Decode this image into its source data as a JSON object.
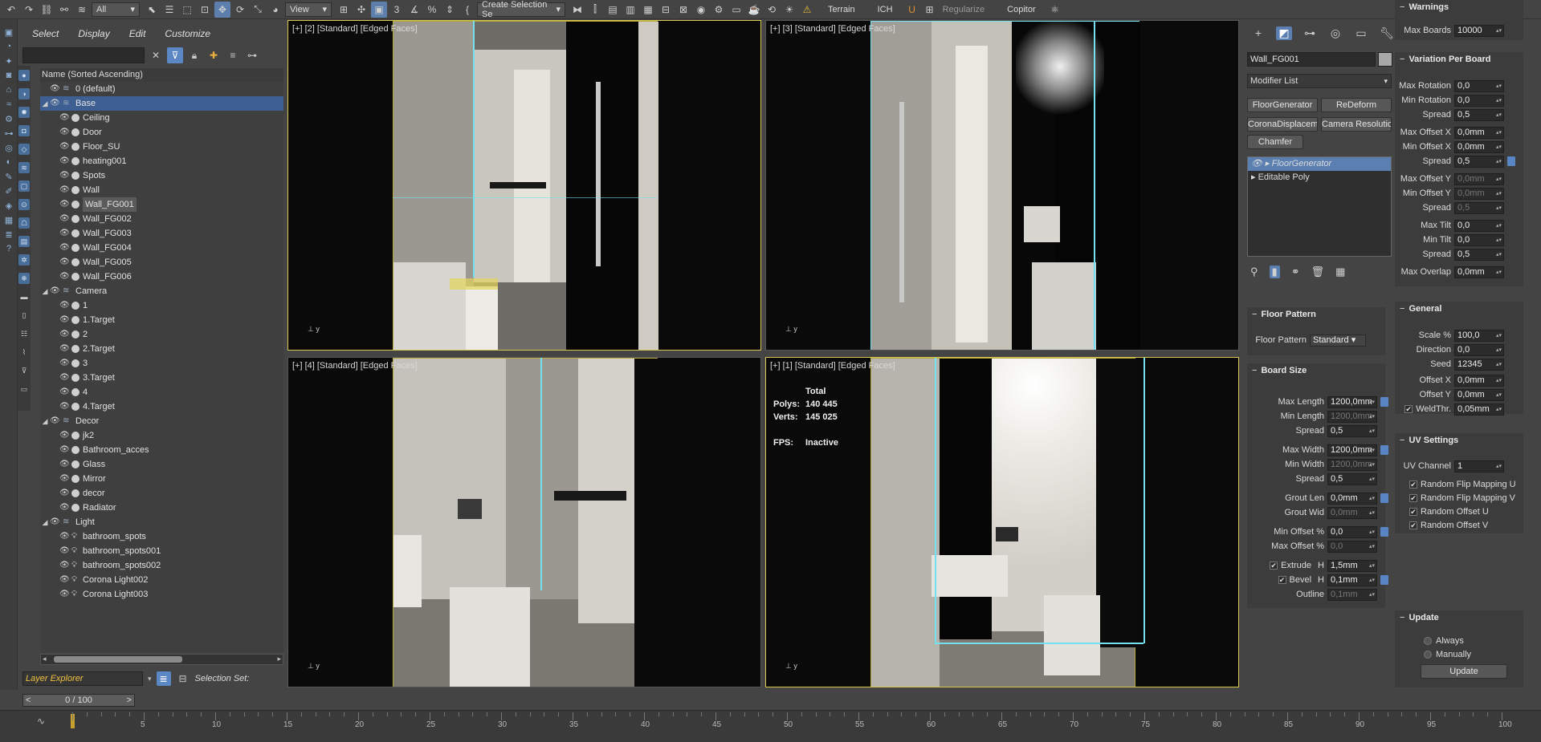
{
  "toolbar": {
    "filter": "All",
    "refcoord": "View",
    "selection_set": "Create Selection Se",
    "terrain": "Terrain",
    "ich": "ICH",
    "regularize": "Regularize",
    "copitor": "Copitor"
  },
  "explorer": {
    "menus": [
      "Select",
      "Display",
      "Edit",
      "Customize"
    ],
    "column_header": "Name (Sorted Ascending)",
    "tree": [
      {
        "label": "0 (default)",
        "kind": "layer",
        "level": 1
      },
      {
        "label": "Base",
        "kind": "layer",
        "level": 0,
        "selected": true
      },
      {
        "label": "Ceiling",
        "kind": "obj",
        "level": 2
      },
      {
        "label": "Door",
        "kind": "obj",
        "level": 2
      },
      {
        "label": "Floor_SU",
        "kind": "obj",
        "level": 2
      },
      {
        "label": "heating001",
        "kind": "obj",
        "level": 2
      },
      {
        "label": "Spots",
        "kind": "obj",
        "level": 2
      },
      {
        "label": "Wall",
        "kind": "obj",
        "level": 2
      },
      {
        "label": "Wall_FG001",
        "kind": "obj",
        "level": 2,
        "highlight": true
      },
      {
        "label": "Wall_FG002",
        "kind": "obj",
        "level": 2
      },
      {
        "label": "Wall_FG003",
        "kind": "obj",
        "level": 2
      },
      {
        "label": "Wall_FG004",
        "kind": "obj",
        "level": 2
      },
      {
        "label": "Wall_FG005",
        "kind": "obj",
        "level": 2
      },
      {
        "label": "Wall_FG006",
        "kind": "obj",
        "level": 2
      },
      {
        "label": "Camera",
        "kind": "layer",
        "level": 0
      },
      {
        "label": "1",
        "kind": "obj",
        "level": 2
      },
      {
        "label": "1.Target",
        "kind": "obj",
        "level": 2
      },
      {
        "label": "2",
        "kind": "obj",
        "level": 2
      },
      {
        "label": "2.Target",
        "kind": "obj",
        "level": 2
      },
      {
        "label": "3",
        "kind": "obj",
        "level": 2
      },
      {
        "label": "3.Target",
        "kind": "obj",
        "level": 2
      },
      {
        "label": "4",
        "kind": "obj",
        "level": 2
      },
      {
        "label": "4.Target",
        "kind": "obj",
        "level": 2
      },
      {
        "label": "Decor",
        "kind": "layer",
        "level": 0
      },
      {
        "label": "jk2",
        "kind": "obj",
        "level": 2
      },
      {
        "label": "Bathroom_acces",
        "kind": "obj",
        "level": 2
      },
      {
        "label": "Glass",
        "kind": "obj",
        "level": 2
      },
      {
        "label": "Mirror",
        "kind": "obj",
        "level": 2
      },
      {
        "label": "decor",
        "kind": "obj",
        "level": 2
      },
      {
        "label": "Radiator",
        "kind": "obj",
        "level": 2
      },
      {
        "label": "Light",
        "kind": "layer",
        "level": 0
      },
      {
        "label": "bathroom_spots",
        "kind": "light",
        "level": 2
      },
      {
        "label": "bathroom_spots001",
        "kind": "light",
        "level": 2
      },
      {
        "label": "bathroom_spots002",
        "kind": "light",
        "level": 2
      },
      {
        "label": "Corona Light002",
        "kind": "light",
        "level": 2
      },
      {
        "label": "Corona Light003",
        "kind": "light",
        "level": 2
      }
    ],
    "layer_explorer": "Layer Explorer",
    "selection_set_label": "Selection Set:"
  },
  "viewports": [
    {
      "label": "[+] [2] [Standard] [Edged Faces]"
    },
    {
      "label": "[+] [3] [Standard] [Edged Faces]"
    },
    {
      "label": "[+] [4] [Standard] [Edged Faces]"
    },
    {
      "label": "[+] [1] [Standard] [Edged Faces]"
    }
  ],
  "stats": {
    "total": "Total",
    "polys_label": "Polys:",
    "polys": "140 445",
    "verts_label": "Verts:",
    "verts": "145 025",
    "fps_label": "FPS:",
    "fps": "Inactive"
  },
  "command": {
    "object_name": "Wall_FG001",
    "modifier_list": "Modifier List",
    "buttons": [
      "FloorGenerator",
      "ReDeform",
      "CoronaDisplaceme",
      "Camera Resolutio",
      "Chamfer"
    ],
    "stack": [
      "FloorGenerator",
      "Editable Poly"
    ]
  },
  "floor_pattern": {
    "title": "Floor Pattern",
    "label": "Floor Pattern",
    "value": "Standard"
  },
  "board_size": {
    "title": "Board Size",
    "rows": [
      {
        "label": "Max Length",
        "value": "1200,0mm",
        "lock": true
      },
      {
        "label": "Min Length",
        "value": "1200,0mm",
        "disabled": true
      },
      {
        "label": "Spread",
        "value": "0,5"
      },
      {
        "label": "Max Width",
        "value": "1200,0mm",
        "lock": true
      },
      {
        "label": "Min Width",
        "value": "1200,0mm",
        "disabled": true
      },
      {
        "label": "Spread",
        "value": "0,5"
      },
      {
        "label": "Grout Len",
        "value": "0,0mm",
        "lock": true
      },
      {
        "label": "Grout Wid",
        "value": "0,0mm",
        "disabled": true
      },
      {
        "label": "Min Offset %",
        "value": "0,0",
        "lock": true
      },
      {
        "label": "Max Offset %",
        "value": "0,0",
        "disabled": true
      },
      {
        "label": "Extrude",
        "sub": "H",
        "value": "1,5mm",
        "check": true
      },
      {
        "label": "Bevel",
        "sub": "H",
        "value": "0,1mm",
        "check": true,
        "lock": true
      },
      {
        "label": "Outline",
        "value": "0,1mm",
        "disabled": true
      }
    ]
  },
  "variation": {
    "title": "Variation Per Board",
    "rows": [
      {
        "label": "Max Rotation",
        "value": "0,0"
      },
      {
        "label": "Min Rotation",
        "value": "0,0"
      },
      {
        "label": "Spread",
        "value": "0,5"
      },
      {
        "label": "Max Offset X",
        "value": "0,0mm"
      },
      {
        "label": "Min Offset X",
        "value": "0,0mm"
      },
      {
        "label": "Spread",
        "value": "0,5",
        "lock": true
      },
      {
        "label": "Max Offset Y",
        "value": "0,0mm",
        "disabled": true
      },
      {
        "label": "Min Offset Y",
        "value": "0,0mm",
        "disabled": true
      },
      {
        "label": "Spread",
        "value": "0,5",
        "disabled": true
      },
      {
        "label": "Max Tilt",
        "value": "0,0"
      },
      {
        "label": "Min Tilt",
        "value": "0,0"
      },
      {
        "label": "Spread",
        "value": "0,5"
      },
      {
        "label": "Max Overlap",
        "value": "0,0mm"
      }
    ]
  },
  "general": {
    "title": "General",
    "rows": [
      {
        "label": "Scale %",
        "value": "100,0"
      },
      {
        "label": "Direction",
        "value": "0,0"
      },
      {
        "label": "Seed",
        "value": "12345"
      },
      {
        "label": "Offset X",
        "value": "0,0mm"
      },
      {
        "label": "Offset Y",
        "value": "0,0mm"
      },
      {
        "label": "WeldThr.",
        "value": "0,05mm",
        "check": true
      }
    ]
  },
  "uv": {
    "title": "UV Settings",
    "channel_label": "UV Channel",
    "channel": "1",
    "checks": [
      "Random Flip Mapping U",
      "Random Flip Mapping V",
      "Random Offset U",
      "Random Offset V"
    ]
  },
  "warnings": {
    "title": "Warnings",
    "label": "Max Boards",
    "value": "10000"
  },
  "update": {
    "title": "Update",
    "always": "Always",
    "manually": "Manually",
    "button": "Update"
  },
  "timeline": {
    "frame": "0 / 100",
    "ticks": [
      "5",
      "10",
      "15",
      "20",
      "25",
      "30",
      "35",
      "40",
      "45",
      "50",
      "55",
      "60",
      "65",
      "70",
      "75",
      "80",
      "85",
      "90",
      "95",
      "100"
    ]
  }
}
